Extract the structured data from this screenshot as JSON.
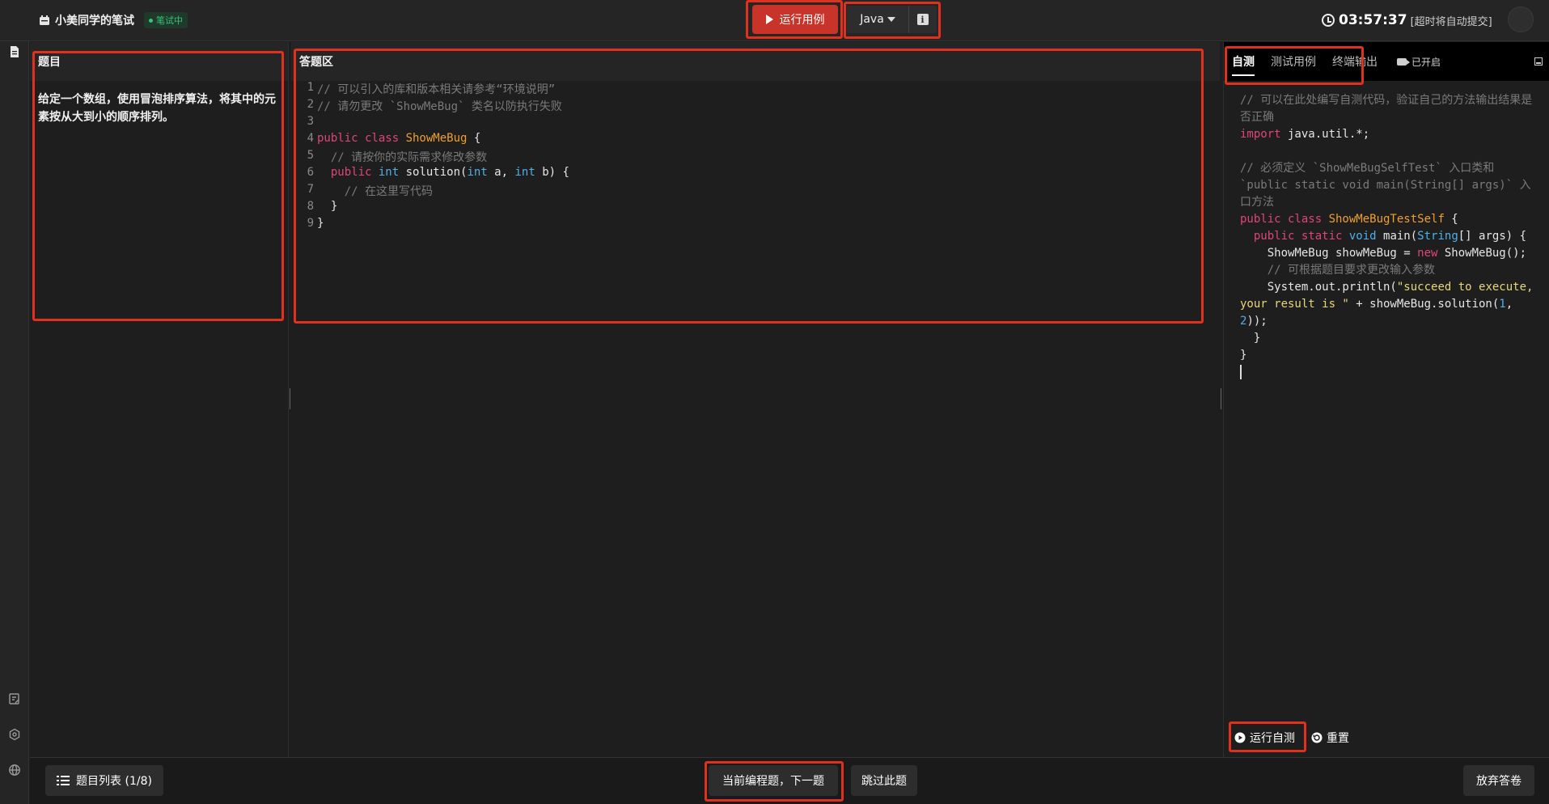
{
  "header": {
    "title": "小美同学的笔试",
    "status_badge": "笔试中",
    "run_button": "运行用例",
    "language": "Java",
    "info_icon": "i",
    "timer": "03:57:37",
    "timer_note": "[超时将自动提交]"
  },
  "left_panel": {
    "title": "题目",
    "problem": "给定一个数组，使用冒泡排序算法，将其中的元素按从大到小的顺序排列。"
  },
  "mid_panel": {
    "title": "答题区",
    "code_lines": [
      {
        "n": "1",
        "parts": [
          {
            "c": "cmt",
            "t": "// 可以引入的库和版本相关请参考“环境说明”"
          }
        ]
      },
      {
        "n": "2",
        "parts": [
          {
            "c": "cmt",
            "t": "// 请勿更改 `ShowMeBug` 类名以防执行失败"
          }
        ]
      },
      {
        "n": "3",
        "parts": []
      },
      {
        "n": "4",
        "parts": [
          {
            "c": "kw",
            "t": "public class "
          },
          {
            "c": "cls",
            "t": "ShowMeBug"
          },
          {
            "c": "pl",
            "t": " {"
          }
        ]
      },
      {
        "n": "5",
        "parts": [
          {
            "c": "cmt",
            "t": "  // 请按你的实际需求修改参数"
          }
        ]
      },
      {
        "n": "6",
        "parts": [
          {
            "c": "kw",
            "t": "  public "
          },
          {
            "c": "typ",
            "t": "int"
          },
          {
            "c": "pl",
            "t": " solution("
          },
          {
            "c": "typ",
            "t": "int"
          },
          {
            "c": "pl",
            "t": " a, "
          },
          {
            "c": "typ",
            "t": "int"
          },
          {
            "c": "pl",
            "t": " b) {"
          }
        ]
      },
      {
        "n": "7",
        "parts": [
          {
            "c": "cmt",
            "t": "    // 在这里写代码"
          }
        ]
      },
      {
        "n": "8",
        "parts": [
          {
            "c": "pl",
            "t": "  }"
          }
        ]
      },
      {
        "n": "9",
        "parts": [
          {
            "c": "pl",
            "t": "}"
          }
        ]
      }
    ]
  },
  "right_panel": {
    "tabs": [
      "自测",
      "测试用例",
      "终端输出"
    ],
    "recording": "已开启",
    "self_test_code": [
      [
        {
          "c": "cmt",
          "t": "// 可以在此处编写自测代码，验证自己的方法输出结果是否正确"
        }
      ],
      [
        {
          "c": "kw",
          "t": "import"
        },
        {
          "c": "pl",
          "t": " java.util.*;"
        }
      ],
      [],
      [
        {
          "c": "cmt",
          "t": "// 必须定义 `ShowMeBugSelfTest` 入口类和 `public static void main(String[] args)` 入口方法"
        }
      ],
      [
        {
          "c": "kw",
          "t": "public class "
        },
        {
          "c": "cls",
          "t": "ShowMeBugTestSelf"
        },
        {
          "c": "pl",
          "t": " {"
        }
      ],
      [
        {
          "c": "kw",
          "t": "  public static "
        },
        {
          "c": "typ",
          "t": "void"
        },
        {
          "c": "pl",
          "t": " main("
        },
        {
          "c": "typ",
          "t": "String"
        },
        {
          "c": "pl",
          "t": "[] args) {"
        }
      ],
      [
        {
          "c": "pl",
          "t": "    ShowMeBug showMeBug = "
        },
        {
          "c": "kw",
          "t": "new"
        },
        {
          "c": "pl",
          "t": " ShowMeBug();"
        }
      ],
      [
        {
          "c": "cmt",
          "t": "    // 可根据题目要求更改输入参数"
        }
      ],
      [
        {
          "c": "pl",
          "t": "    System.out.println("
        },
        {
          "c": "str",
          "t": "\"succeed to execute, your result is \""
        },
        {
          "c": "pl",
          "t": " + showMeBug.solution("
        },
        {
          "c": "num",
          "t": "1"
        },
        {
          "c": "pl",
          "t": ", "
        },
        {
          "c": "num",
          "t": "2"
        },
        {
          "c": "pl",
          "t": "));"
        }
      ],
      [
        {
          "c": "pl",
          "t": "  }"
        }
      ],
      [
        {
          "c": "pl",
          "t": "}"
        }
      ]
    ],
    "run_self_test": "运行自测",
    "reset": "重置"
  },
  "footer": {
    "question_list": "题目列表 (1/8)",
    "next": "当前编程题，下一题",
    "skip": "跳过此题",
    "abandon": "放弃答卷"
  },
  "colors": {
    "accent_red": "#c8342a",
    "highlight": "#e0301e",
    "badge_green": "#37c37a"
  }
}
